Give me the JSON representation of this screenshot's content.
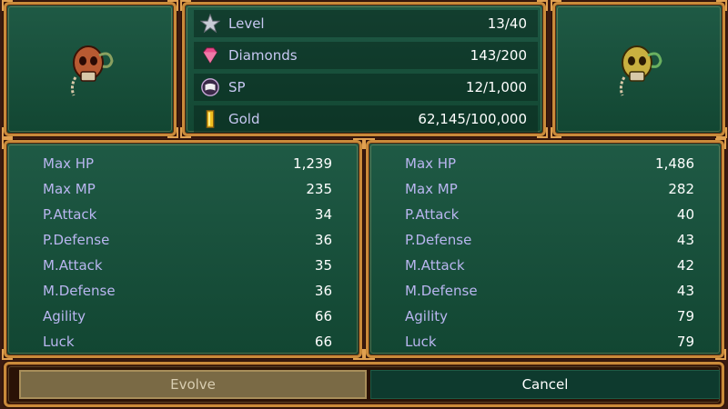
{
  "info": {
    "rows": [
      {
        "icon": "star-icon",
        "label": "Level",
        "value": "13/40"
      },
      {
        "icon": "diamond-icon",
        "label": "Diamonds",
        "value": "143/200"
      },
      {
        "icon": "sp-book-icon",
        "label": "SP",
        "value": "12/1,000"
      },
      {
        "icon": "gold-bar-icon",
        "label": "Gold",
        "value": "62,145/100,000"
      }
    ]
  },
  "portraits": {
    "left": {
      "icon": "skull-monster-icon",
      "color": "#b85a32"
    },
    "right": {
      "icon": "skull-monster-evolved-icon",
      "color": "#c9b040"
    }
  },
  "stats_current": [
    {
      "label": "Max HP",
      "value": "1,239"
    },
    {
      "label": "Max MP",
      "value": "235"
    },
    {
      "label": "P.Attack",
      "value": "34"
    },
    {
      "label": "P.Defense",
      "value": "36"
    },
    {
      "label": "M.Attack",
      "value": "35"
    },
    {
      "label": "M.Defense",
      "value": "36"
    },
    {
      "label": "Agility",
      "value": "66"
    },
    {
      "label": "Luck",
      "value": "66"
    }
  ],
  "stats_evolved": [
    {
      "label": "Max HP",
      "value": "1,486"
    },
    {
      "label": "Max MP",
      "value": "282"
    },
    {
      "label": "P.Attack",
      "value": "40"
    },
    {
      "label": "P.Defense",
      "value": "43"
    },
    {
      "label": "M.Attack",
      "value": "42"
    },
    {
      "label": "M.Defense",
      "value": "43"
    },
    {
      "label": "Agility",
      "value": "79"
    },
    {
      "label": "Luck",
      "value": "79"
    }
  ],
  "buttons": {
    "evolve": "Evolve",
    "cancel": "Cancel"
  }
}
